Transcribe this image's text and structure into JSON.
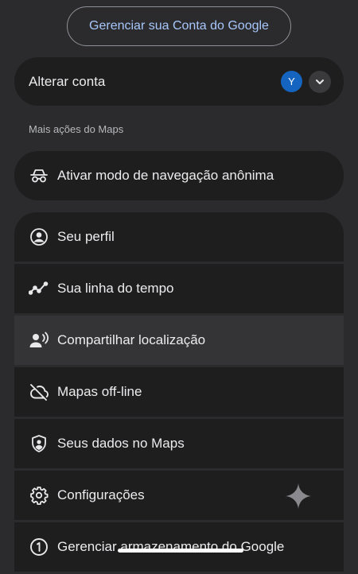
{
  "header": {
    "manage_account_label": "Gerenciar sua Conta do Google"
  },
  "account": {
    "switch_label": "Alterar conta",
    "avatar_initial": "Y",
    "avatar_color": "#1565c0"
  },
  "section": {
    "label": "Mais ações do Maps"
  },
  "incognito": {
    "label": "Ativar modo de navegação anônima",
    "icon": "incognito-icon"
  },
  "menu": {
    "items": [
      {
        "label": "Seu perfil",
        "icon": "account-circle-icon"
      },
      {
        "label": "Sua linha do tempo",
        "icon": "timeline-icon"
      },
      {
        "label": "Compartilhar localização",
        "icon": "share-location-icon"
      },
      {
        "label": "Mapas off-line",
        "icon": "cloud-off-icon"
      },
      {
        "label": "Seus dados no Maps",
        "icon": "shield-person-icon"
      },
      {
        "label": "Configurações",
        "icon": "gear-icon"
      },
      {
        "label": "Gerenciar armazenamento do Google",
        "icon": "storage-one-icon"
      }
    ]
  },
  "colors": {
    "background": "#2b2b2e",
    "card": "#1e1e1f",
    "highlight": "#343437",
    "link_blue": "#a8c7fa"
  }
}
